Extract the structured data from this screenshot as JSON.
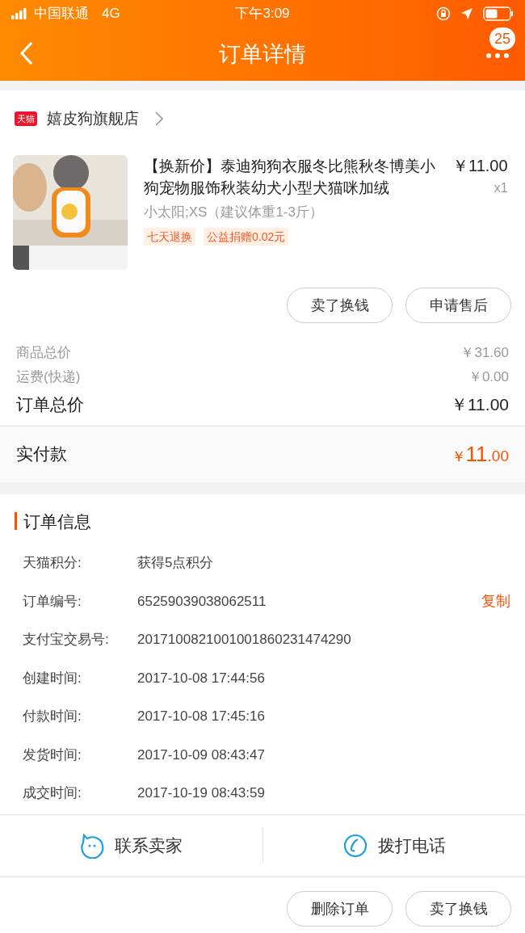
{
  "status_bar": {
    "carrier": "中国联通",
    "network": "4G",
    "time": "下午3:09"
  },
  "nav": {
    "title": "订单详情",
    "badge": "25"
  },
  "shop": {
    "badge": "天猫",
    "name": "嬉皮狗旗舰店"
  },
  "product": {
    "kind": "picture",
    "title": "【换新价】泰迪狗狗衣服冬比熊秋冬博美小狗宠物服饰秋装幼犬小型犬猫咪加绒",
    "price": "￥11.00",
    "quantity": "x1",
    "sku": "小太阳;XS（建议体重1-3斤）",
    "tags": [
      "七天退换",
      "公益捐赠0.02元"
    ]
  },
  "item_buttons": [
    "卖了换钱",
    "申请售后"
  ],
  "summary": [
    {
      "label": "商品总价",
      "value": "￥31.60",
      "emphasis": false
    },
    {
      "label": "运费(快递)",
      "value": "￥0.00",
      "emphasis": false
    },
    {
      "label": "订单总价",
      "value": "￥11.00",
      "emphasis": true
    }
  ],
  "paid": {
    "label": "实付款",
    "currency": "￥",
    "integer": "11",
    "decimal": ".00"
  },
  "order_info": {
    "title": "订单信息",
    "rows": [
      {
        "label": "天猫积分:",
        "value": "获得5点积分"
      },
      {
        "label": "订单编号:",
        "value": "65259039038062511",
        "action": "复制"
      },
      {
        "label": "支付宝交易号:",
        "value": "2017100821001001860231474290"
      },
      {
        "label": "创建时间:",
        "value": "2017-10-08 17:44:56"
      },
      {
        "label": "付款时间:",
        "value": "2017-10-08 17:45:16"
      },
      {
        "label": "发货时间:",
        "value": "2017-10-09 08:43:47"
      },
      {
        "label": "成交时间:",
        "value": "2017-10-19 08:43:59"
      }
    ]
  },
  "contact": [
    {
      "kind": "chat",
      "label": "联系卖家"
    },
    {
      "kind": "phone",
      "label": "拨打电话"
    }
  ],
  "bottom_buttons": [
    "删除订单",
    "卖了换钱"
  ]
}
